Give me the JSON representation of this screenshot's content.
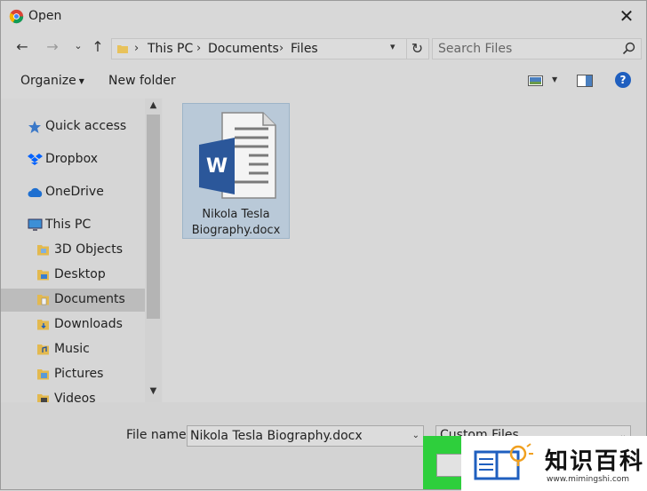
{
  "window": {
    "title": "Open"
  },
  "address": {
    "crumbs": [
      "This PC",
      "Documents",
      "Files"
    ]
  },
  "search": {
    "placeholder": "Search Files"
  },
  "toolbar": {
    "organize_label": "Organize",
    "new_folder_label": "New folder"
  },
  "sidebar": {
    "items": [
      {
        "label": "Quick access",
        "icon": "star-icon"
      },
      {
        "label": "Dropbox",
        "icon": "dropbox-icon"
      },
      {
        "label": "OneDrive",
        "icon": "cloud-icon"
      },
      {
        "label": "This PC",
        "icon": "computer-icon"
      },
      {
        "label": "3D Objects",
        "icon": "folder-icon"
      },
      {
        "label": "Desktop",
        "icon": "folder-icon"
      },
      {
        "label": "Documents",
        "icon": "folder-icon",
        "selected": true
      },
      {
        "label": "Downloads",
        "icon": "folder-icon"
      },
      {
        "label": "Music",
        "icon": "folder-icon"
      },
      {
        "label": "Pictures",
        "icon": "folder-icon"
      },
      {
        "label": "Videos",
        "icon": "folder-icon"
      }
    ]
  },
  "files": [
    {
      "name_line1": "Nikola Tesla",
      "name_line2": "Biography.docx",
      "icon": "word-document-icon",
      "selected": true
    }
  ],
  "footer": {
    "file_name_label": "File name:",
    "file_name_value": "Nikola Tesla Biography.docx",
    "file_type_value": "Custom Files"
  },
  "watermark": {
    "title": "知识百科",
    "url": "www.mimingshi.com"
  },
  "colors": {
    "accent": "#1f5fbf",
    "word_blue": "#2b579a",
    "selection": "#b9c9d8",
    "highlight_green": "#2ecf3c"
  }
}
